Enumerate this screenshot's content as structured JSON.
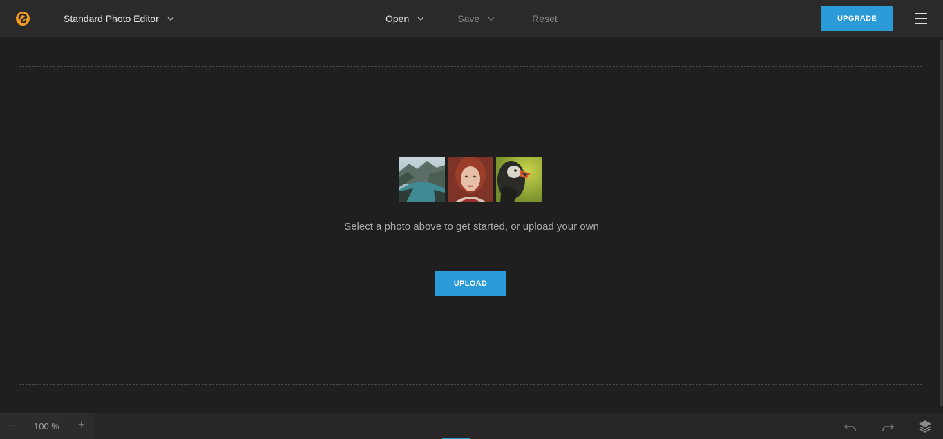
{
  "header": {
    "app_name": "Standard Photo Editor",
    "menu": {
      "open": "Open",
      "save": "Save",
      "reset": "Reset"
    },
    "upgrade_label": "UPGRADE"
  },
  "main": {
    "samples": [
      {
        "name": "lake-landscape"
      },
      {
        "name": "woman-portrait"
      },
      {
        "name": "puffin-bird"
      }
    ],
    "hint": "Select a photo above to get started, or upload your own",
    "upload_label": "UPLOAD"
  },
  "footer": {
    "zoom_minus": "−",
    "zoom_value": "100 %",
    "zoom_plus": "+"
  },
  "colors": {
    "accent": "#2a9bd6",
    "logo": "#f39c1f",
    "background": "#1f1f1f",
    "topbar": "#2a2a2a"
  },
  "icons": [
    "logo-icon",
    "chevron-down-icon",
    "hamburger-menu-icon",
    "undo-icon",
    "redo-icon",
    "layers-icon"
  ]
}
